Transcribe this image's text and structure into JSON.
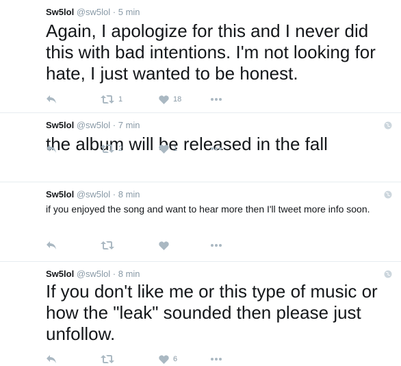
{
  "tweets": [
    {
      "name": "Sw5lol",
      "handle": "@sw5lol",
      "separator": "·",
      "time": "5 min",
      "text": "Again, I apologize for this and I never did this with bad intentions. I'm not looking for hate, I just wanted to be honest.",
      "retweets": "1",
      "likes": "18"
    },
    {
      "name": "Sw5lol",
      "handle": "@sw5lol",
      "separator": "·",
      "time": "7 min",
      "text": "the album will be released in the fall",
      "retweets": "2",
      "likes": "1"
    },
    {
      "name": "Sw5lol",
      "handle": "@sw5lol",
      "separator": "·",
      "time": "8 min",
      "text": "if you enjoyed the song and want to hear more then I'll tweet more info soon.",
      "retweets": "",
      "likes": ""
    },
    {
      "name": "Sw5lol",
      "handle": "@sw5lol",
      "separator": "·",
      "time": "8 min",
      "text": "If you don't like me or this type of music or how the \"leak\" sounded then please just unfollow.",
      "retweets": "",
      "likes": "6"
    }
  ],
  "colors": {
    "icon": "#aab8c2",
    "muted": "#8899a6",
    "text": "#14171a",
    "divider": "#e6ecf0"
  },
  "icons": [
    "reply-icon",
    "retweet-icon",
    "like-icon",
    "more-icon",
    "globe-icon"
  ]
}
